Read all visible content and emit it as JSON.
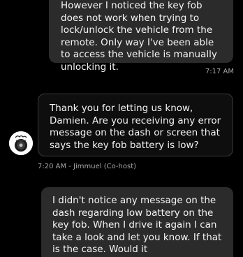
{
  "messages": [
    {
      "direction": "outgoing",
      "text": "However I noticed the key fob does not work when trying to lock/unlock the vehicle from the remote. Only way I've been able to access the vehicle is manually unlocking it.",
      "time": "7:17 AM"
    },
    {
      "direction": "incoming",
      "text": "Thank you for letting us know, Damien. Are you receiving any error message on the dash or screen that says the key fob battery is low?",
      "meta": "7:20 AM - Jimmuel (Co-host)",
      "avatar": "host-avatar-icon"
    },
    {
      "direction": "outgoing",
      "text": "I didn't notice any message on the dash regarding low battery on the key fob. When I drive it again I can take a look and let you know. If that is the case. Would it"
    }
  ],
  "colors": {
    "background": "#000000",
    "outgoing_bubble": "#2b2b2b",
    "incoming_bubble": "#0e0e0e",
    "incoming_border": "#3a3a3a",
    "meta_text": "#a6a6a6"
  }
}
